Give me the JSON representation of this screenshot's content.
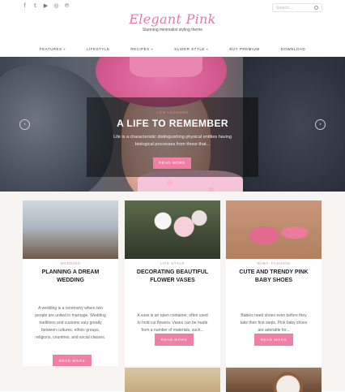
{
  "topbar": {
    "social_icons": [
      "facebook-icon",
      "twitter-icon",
      "youtube-icon",
      "instagram-icon",
      "pinterest-icon"
    ],
    "search_placeholder": "Search ..."
  },
  "site": {
    "logo": "Elegant Pink",
    "tagline": "Stunning minimalist styling theme"
  },
  "nav": {
    "items": [
      {
        "label": "Features",
        "dropdown": true
      },
      {
        "label": "Lifestyle",
        "dropdown": false
      },
      {
        "label": "Recipes",
        "dropdown": true
      },
      {
        "label": "Slider Style",
        "dropdown": true
      },
      {
        "label": "Buy Premium",
        "dropdown": false
      },
      {
        "label": "Download",
        "dropdown": false
      }
    ]
  },
  "hero": {
    "category": "Life Lessons",
    "title": "A LIFE TO REMEMBER",
    "excerpt": "Life is a characteristic distinguishing physical entities having biological processes from those that...",
    "button": "Read More",
    "prev": "‹",
    "next": "›"
  },
  "cards": [
    {
      "category": "Wedding",
      "title": "Planning a Dream Wedding",
      "excerpt": "A wedding is a ceremony where two people are united in marriage. Wedding traditions and customs vary greatly between cultures, ethnic groups, religions, countries, and social classes.",
      "button": "Read More"
    },
    {
      "category": "Life Style",
      "title": "Decorating Beautiful Flower Vases",
      "excerpt": "A vase is an open container, often used to hold cut flowers. Vases can be made from a number of materials, such...",
      "button": "Read More"
    },
    {
      "category": "Baby, Fashion",
      "title": "Cute and Trendy Pink Baby Shoes",
      "excerpt": "Babies need shoes even before they take their first steps. Pink baby shoes are adorable for...",
      "button": "Read More"
    }
  ],
  "colors": {
    "accent": "#f07fa6",
    "logo": "#e47ca6"
  }
}
